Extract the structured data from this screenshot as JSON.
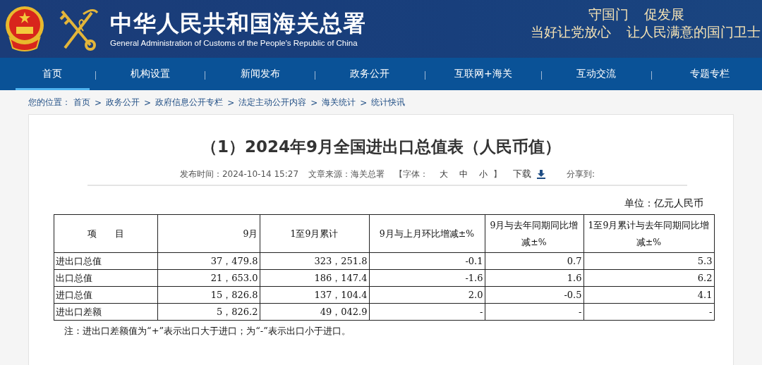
{
  "header": {
    "title": "中华人民共和国海关总署",
    "subtitle": "General Administration of Customs of the People's Republic of China",
    "slogans": [
      [
        "守国门",
        "促发展"
      ],
      [
        "当好让党放心",
        "让人民满意的国门卫士"
      ]
    ]
  },
  "nav": [
    {
      "label": "首页",
      "selected": true
    },
    {
      "label": "机构设置",
      "selected": false
    },
    {
      "label": "新闻发布",
      "selected": false
    },
    {
      "label": "政务公开",
      "selected": false
    },
    {
      "label": "互联网+海关",
      "selected": false
    },
    {
      "label": "互动交流",
      "selected": false
    },
    {
      "label": "专题专栏",
      "selected": false
    }
  ],
  "breadcrumb": {
    "label": "您的位置：",
    "items": [
      "首页",
      "政务公开",
      "政府信息公开专栏",
      "法定主动公开内容",
      "海关统计",
      "统计快讯"
    ],
    "separator": ">"
  },
  "article": {
    "title": "（1）2024年9月全国进出口总值表（人民币值）",
    "meta": {
      "published_label": "发布时间：",
      "published": "2024-10-14 15:27",
      "source_label": "文章来源：",
      "source": "海关总署",
      "font_open": "【字体：",
      "font_sizes": [
        "大",
        "中",
        "小"
      ],
      "font_close": "】",
      "download": "下载",
      "share": "分享到:"
    },
    "unit": "单位：亿元人民币",
    "table": {
      "columns": [
        "项　　目",
        "9月",
        "1至9月累计",
        "9月与上月环比增减±%",
        "9月与去年同期同比增减±%",
        "1至9月累计与去年同期同比增减±%"
      ],
      "rows": [
        [
          "进出口总值",
          "37，479.8",
          "323，251.8",
          "-0.1",
          "0.7",
          "5.3"
        ],
        [
          "出口总值",
          "21，653.0",
          "186，147.4",
          "-1.6",
          "1.6",
          "6.2"
        ],
        [
          "进口总值",
          "15，826.8",
          "137，104.4",
          "2.0",
          "-0.5",
          "4.1"
        ],
        [
          "进出口差额",
          "5，826.2",
          "49，042.9",
          "-",
          "-",
          "-"
        ]
      ]
    },
    "note": "注：进出口差额值为“+”表示出口大于进口；为“-”表示出口小于进口。"
  }
}
